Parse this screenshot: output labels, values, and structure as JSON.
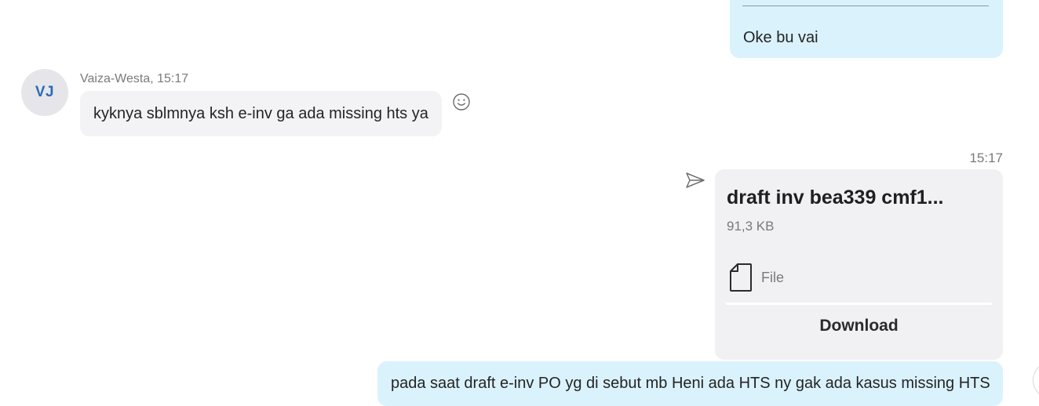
{
  "messages": {
    "top_outgoing": {
      "text": "Oke bu vai"
    },
    "incoming": {
      "avatar_initials": "VJ",
      "sender_meta": "Vaiza-Westa, 15:17",
      "text": "kyknya sblmnya ksh e-inv ga ada missing hts ya"
    },
    "file_message": {
      "time": "15:17",
      "file_name": "draft inv bea339 cmf1...",
      "file_size": "91,3 KB",
      "file_type_label": "File",
      "download_label": "Download"
    },
    "bottom_outgoing": {
      "text": "pada saat draft e-inv PO yg di sebut mb Heni ada HTS ny gak ada kasus missing HTS"
    }
  },
  "icons": {
    "emoji": "emoji-smile-icon",
    "sent": "sent-paper-plane-icon",
    "file": "file-document-icon"
  },
  "colors": {
    "outgoing_bubble": "#daf2fc",
    "incoming_bubble": "#f3f3f5",
    "file_card": "#f1f1f3",
    "avatar_bg": "#e6e6ea",
    "avatar_text": "#2a6bb8"
  }
}
